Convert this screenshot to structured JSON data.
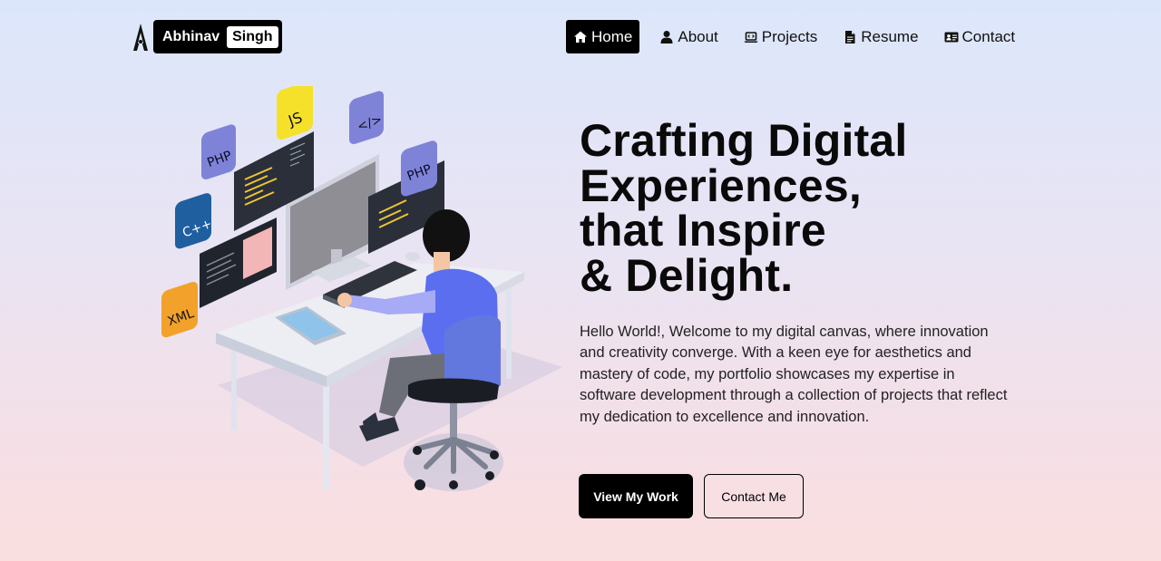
{
  "brand": {
    "first": "Abhinav",
    "last": "Singh"
  },
  "nav": {
    "items": [
      {
        "label": "Home",
        "icon": "home-icon",
        "active": true
      },
      {
        "label": "About",
        "icon": "user-icon"
      },
      {
        "label": "Projects",
        "icon": "laptop-code-icon"
      },
      {
        "label": "Resume",
        "icon": "file-icon"
      },
      {
        "label": "Contact",
        "icon": "id-card-icon"
      }
    ]
  },
  "illustration": {
    "badges": [
      "PHP",
      "JS",
      "</>",
      "PHP",
      "C++",
      "XML"
    ]
  },
  "hero": {
    "title_lines": [
      "Crafting Digital",
      "Experiences,",
      "that Inspire",
      "& Delight."
    ],
    "description": "Hello World!, Welcome to my digital canvas, where innovation and creativity converge. With a keen eye for aesthetics and mastery of code, my portfolio showcases my expertise in software development through a collection of projects that reflect my dedication to excellence and innovation.",
    "primary_button": "View My Work",
    "secondary_button": "Contact Me"
  },
  "colors": {
    "accent": "#000000",
    "bg_top": "#dce6fb",
    "bg_bottom": "#fbdfdf",
    "badge_purple": "#7f83d8",
    "badge_yellow": "#f5e12a",
    "badge_blue": "#1f5fa0",
    "badge_orange": "#f2a12b",
    "person_shirt": "#5b6ef0"
  }
}
